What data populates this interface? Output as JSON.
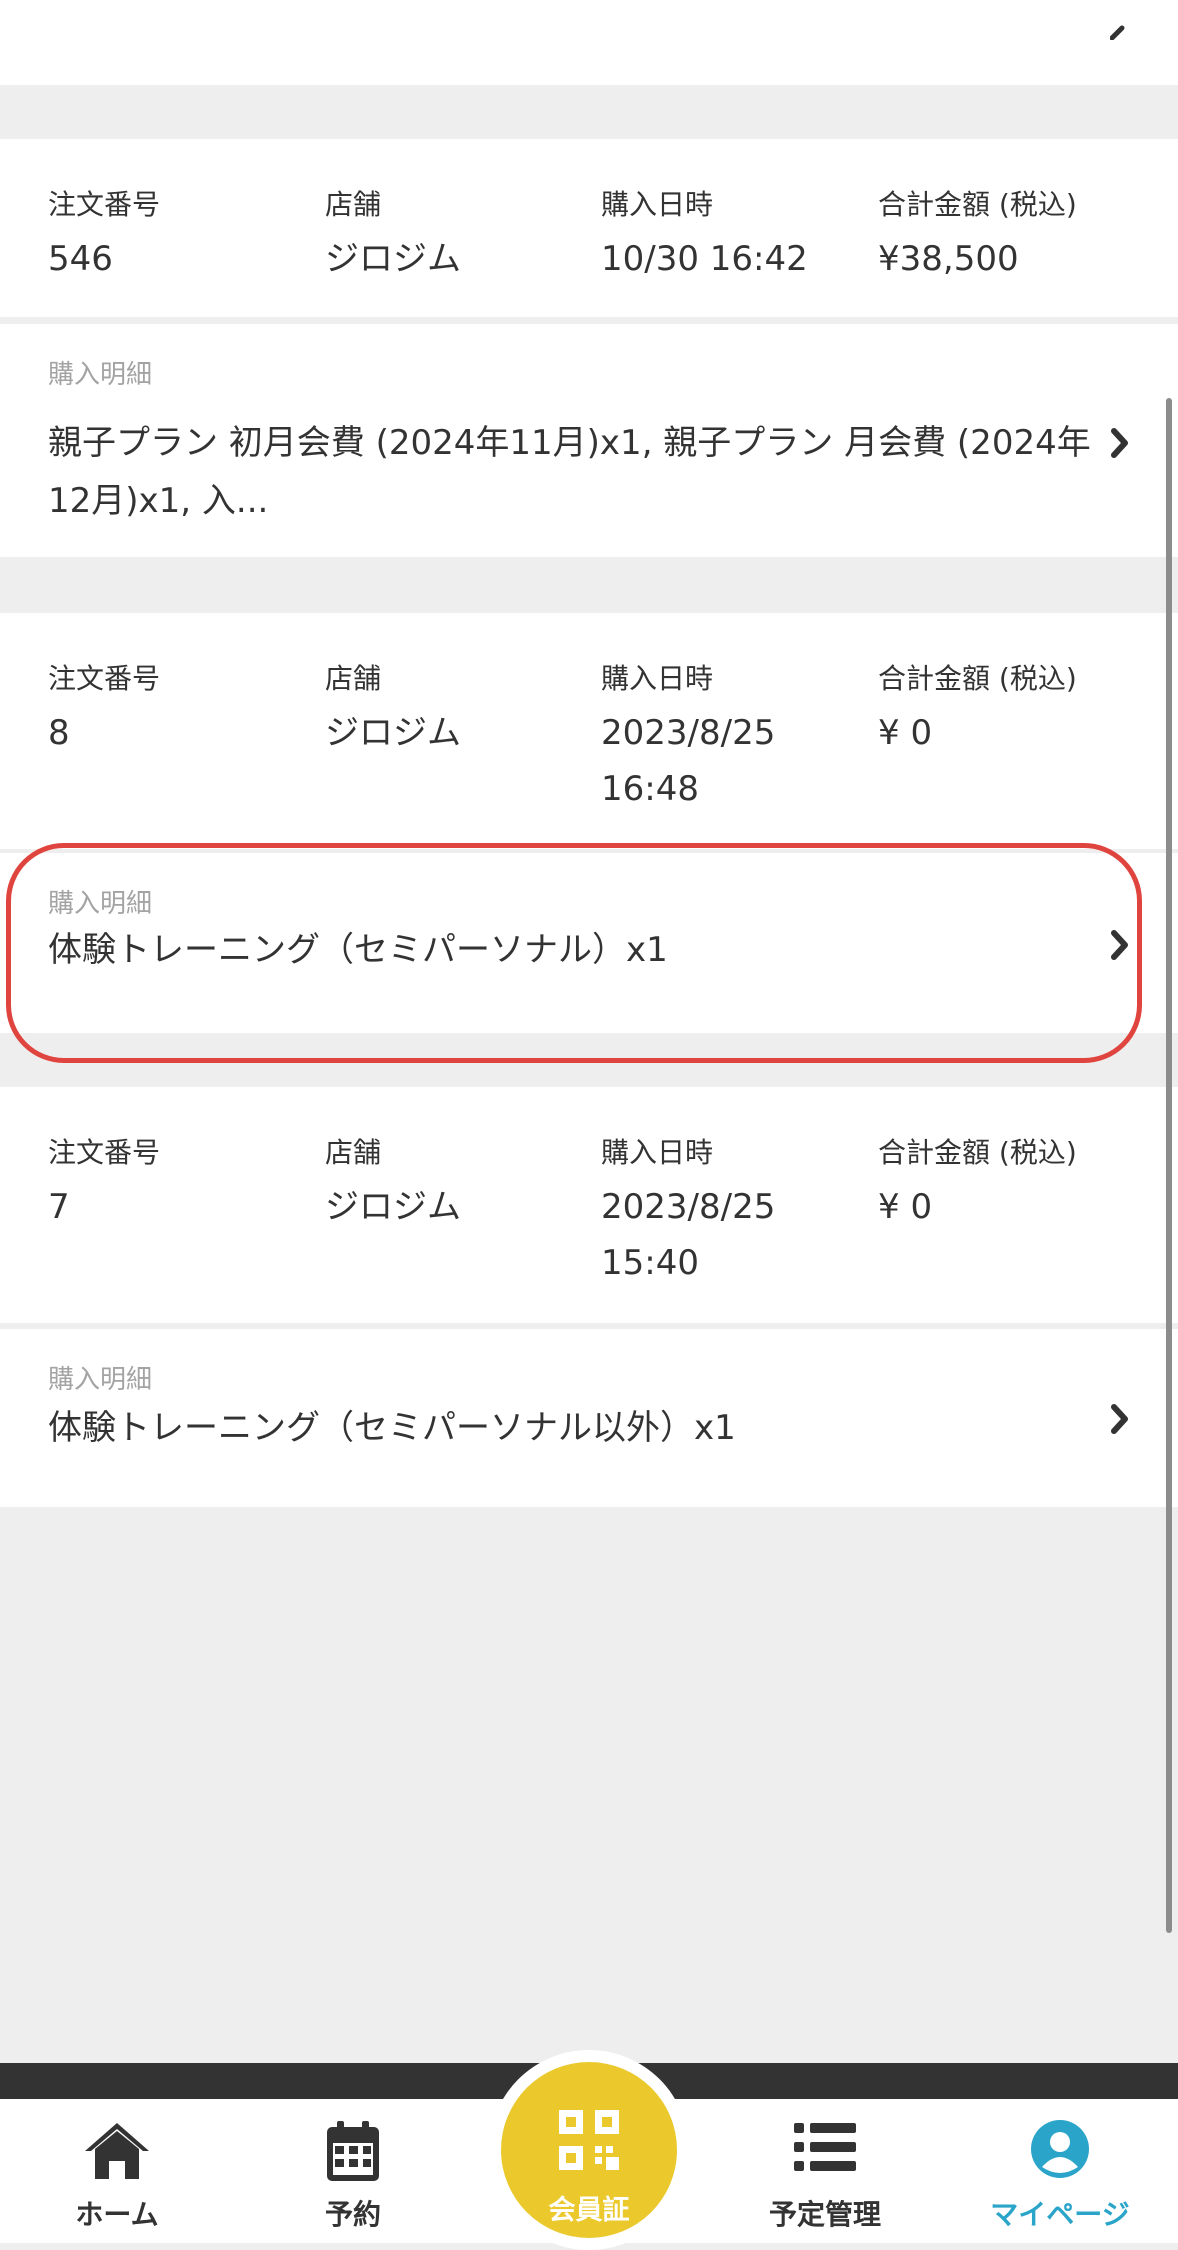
{
  "orders": [
    {
      "labels": {
        "order_no": "注文番号",
        "store": "店舗",
        "date": "購入日時",
        "total": "合計金額 (税込)"
      },
      "order_no": "546",
      "store": "ジロジム",
      "date": "10/30 16:42",
      "total": "¥38,500",
      "detail_label": "購入明細",
      "detail": "親子プラン 初月会費 (2024年11月)x1, 親子プラン 月会費 (2024年12月)x1, 入..."
    },
    {
      "labels": {
        "order_no": "注文番号",
        "store": "店舗",
        "date": "購入日時",
        "total": "合計金額 (税込)"
      },
      "order_no": "8",
      "store": "ジロジム",
      "date": "2023/8/25 16:48",
      "total": "¥ 0",
      "detail_label": "購入明細",
      "detail": "体験トレーニング（セミパーソナル）x1"
    },
    {
      "labels": {
        "order_no": "注文番号",
        "store": "店舗",
        "date": "購入日時",
        "total": "合計金額 (税込)"
      },
      "order_no": "7",
      "store": "ジロジム",
      "date": "2023/8/25 15:40",
      "total": "¥ 0",
      "detail_label": "購入明細",
      "detail": "体験トレーニング（セミパーソナル以外）x1"
    }
  ],
  "nav": {
    "home": "ホーム",
    "reserve": "予約",
    "member_card": "会員証",
    "schedule": "予定管理",
    "mypage": "マイページ"
  },
  "colors": {
    "accent": "#2aa5c9",
    "center_button": "#ebc92c",
    "highlight": "#e0443e",
    "background": "#eeeeee"
  },
  "icons": {
    "nav": [
      "home-icon",
      "calendar-icon",
      "qr-code-icon",
      "list-icon",
      "user-icon"
    ],
    "detail": "chevron-right-icon"
  }
}
